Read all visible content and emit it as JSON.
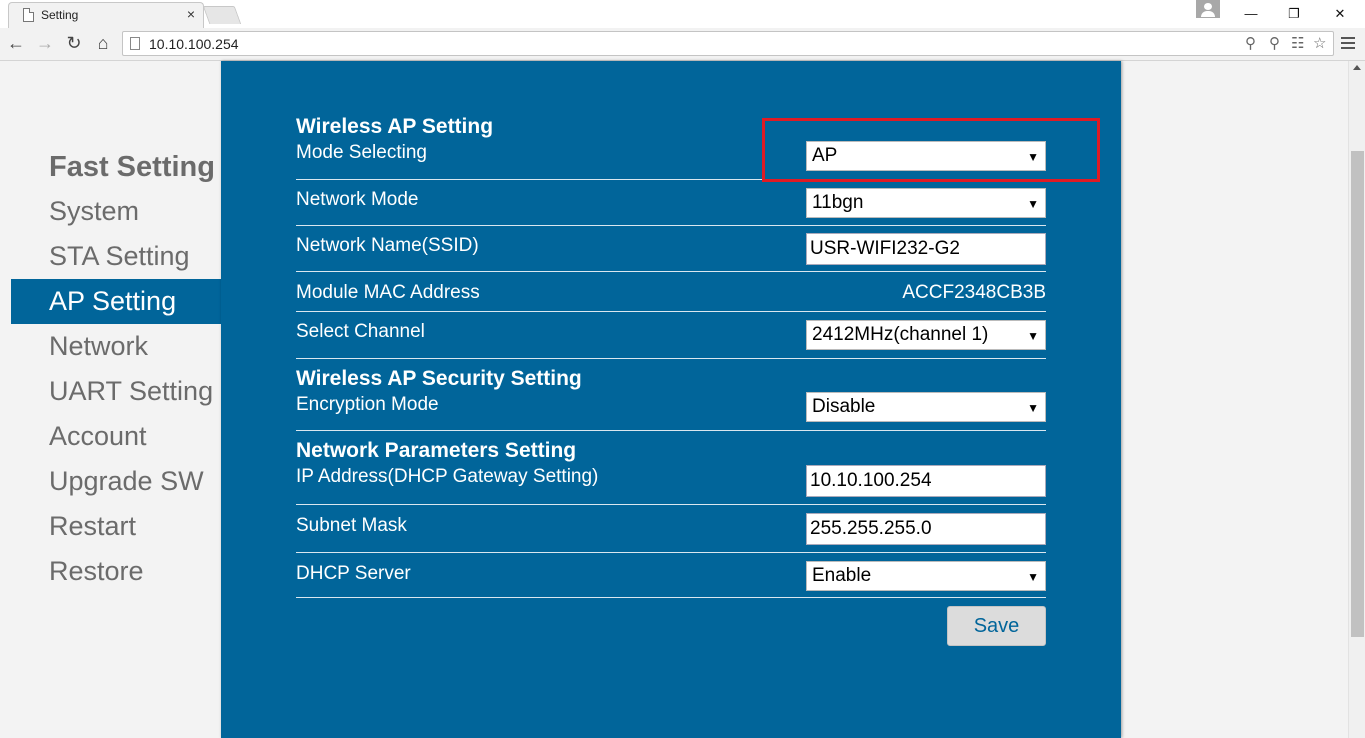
{
  "browser": {
    "tab_title": "Setting",
    "tab_close": "×",
    "url": "10.10.100.254",
    "window_minimize": "—",
    "window_restore": "❐",
    "window_close": "✕"
  },
  "sidebar": {
    "heading": "Fast Setting",
    "items": [
      {
        "label": "System",
        "active": false
      },
      {
        "label": "STA Setting",
        "active": false
      },
      {
        "label": "AP Setting",
        "active": true
      },
      {
        "label": "Network",
        "active": false
      },
      {
        "label": "UART Setting",
        "active": false
      },
      {
        "label": "Account",
        "active": false
      },
      {
        "label": "Upgrade SW",
        "active": false
      },
      {
        "label": "Restart",
        "active": false
      },
      {
        "label": "Restore",
        "active": false
      }
    ]
  },
  "form": {
    "wireless_ap": {
      "title": "Wireless AP Setting",
      "mode_label": "Mode Selecting",
      "mode_value": "AP",
      "network_mode_label": "Network Mode",
      "network_mode_value": "11bgn",
      "ssid_label": "Network Name(SSID)",
      "ssid_value": "USR-WIFI232-G2",
      "mac_label": "Module MAC Address",
      "mac_value": "ACCF2348CB3B",
      "channel_label": "Select Channel",
      "channel_value": "2412MHz(channel 1)"
    },
    "security": {
      "title": "Wireless AP Security Setting",
      "encryption_label": "Encryption Mode",
      "encryption_value": "Disable"
    },
    "network_params": {
      "title": "Network Parameters Setting",
      "ip_label": "IP Address(DHCP Gateway Setting)",
      "ip_value": "10.10.100.254",
      "subnet_label": "Subnet Mask",
      "subnet_value": "255.255.255.0",
      "dhcp_label": "DHCP Server",
      "dhcp_value": "Enable"
    },
    "save_label": "Save"
  },
  "colors": {
    "panel_bg": "#01659a",
    "highlight_border": "#e01b24",
    "sidebar_text": "#6b6b6b"
  }
}
